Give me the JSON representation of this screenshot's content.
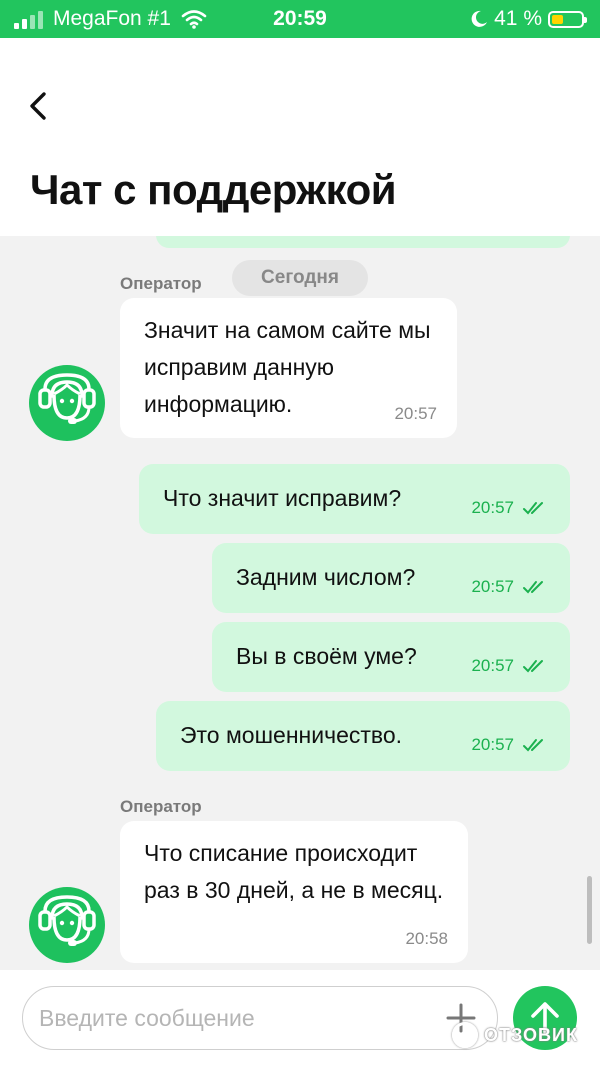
{
  "status_bar": {
    "carrier": "MegaFon #1",
    "time": "20:59",
    "battery_percent": "41 %",
    "battery_level": 0.41
  },
  "header": {
    "title": "Чат с поддержкой"
  },
  "chat": {
    "date_separator": "Сегодня",
    "sender_label": "Оператор",
    "messages": [
      {
        "direction": "in",
        "sender": "Оператор",
        "text": "Значит на самом сайте мы исправим данную информацию.",
        "time": "20:57"
      },
      {
        "direction": "out",
        "text": "Что значит исправим?",
        "time": "20:57",
        "status": "read"
      },
      {
        "direction": "out",
        "text": "Задним числом?",
        "time": "20:57",
        "status": "read"
      },
      {
        "direction": "out",
        "text": "Вы в своём уме?",
        "time": "20:57",
        "status": "read"
      },
      {
        "direction": "out",
        "text": "Это мошенничество.",
        "time": "20:57",
        "status": "read"
      },
      {
        "direction": "in",
        "sender": "Оператор",
        "text": "Что списание происходит раз в 30 дней, а не в месяц.",
        "time": "20:58"
      }
    ]
  },
  "composer": {
    "placeholder": "Введите сообщение",
    "value": ""
  },
  "watermark": "ОТЗОВИК",
  "colors": {
    "brand_green": "#22c55e",
    "outgoing_bubble": "#d2f8de",
    "incoming_bubble": "#ffffff",
    "background": "#f2f2f2"
  },
  "icons": {
    "back": "chevron-left-icon",
    "avatar": "support-operator-headset-icon",
    "ticks": "double-check-icon",
    "attach": "plus-icon",
    "send": "arrow-up-icon"
  }
}
